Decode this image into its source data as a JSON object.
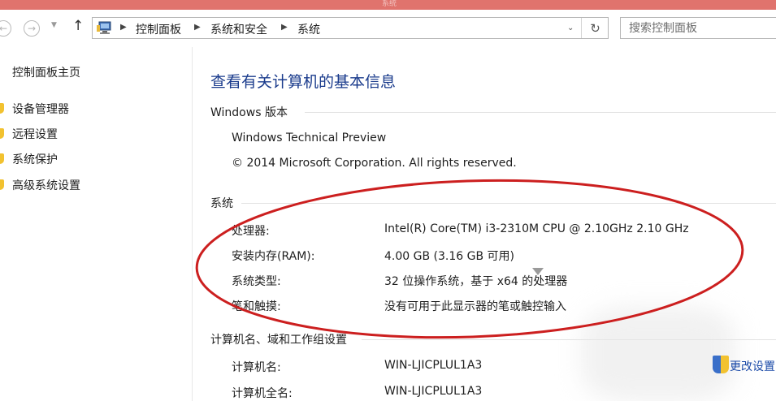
{
  "window": {
    "title": "系统"
  },
  "nav": {
    "back_icon": "arrow-left-icon",
    "forward_icon": "arrow-right-icon",
    "up_icon": "arrow-up-icon"
  },
  "address": {
    "breadcrumbs": [
      "控制面板",
      "系统和安全",
      "系统"
    ]
  },
  "search": {
    "placeholder": "搜索控制面板"
  },
  "sidebar": {
    "home": "控制面板主页",
    "items": [
      {
        "label": "设备管理器"
      },
      {
        "label": "远程设置"
      },
      {
        "label": "系统保护"
      },
      {
        "label": "高级系统设置"
      }
    ]
  },
  "main": {
    "title": "查看有关计算机的基本信息",
    "windows_section": {
      "heading": "Windows 版本",
      "edition": "Windows Technical Preview",
      "copyright": "© 2014 Microsoft Corporation. All rights reserved."
    },
    "system_section": {
      "heading": "系统",
      "rows": [
        {
          "label": "处理器:",
          "value": "Intel(R) Core(TM) i3-2310M CPU @ 2.10GHz   2.10 GHz"
        },
        {
          "label": "安装内存(RAM):",
          "value": "4.00 GB (3.16 GB 可用)"
        },
        {
          "label": "系统类型:",
          "value": "32 位操作系统，基于 x64 的处理器"
        },
        {
          "label": "笔和触摸:",
          "value": "没有可用于此显示器的笔或触控输入"
        }
      ]
    },
    "computer_section": {
      "heading": "计算机名、域和工作组设置",
      "rows": [
        {
          "label": "计算机名:",
          "value": "WIN-LJICPLUL1A3"
        },
        {
          "label": "计算机全名:",
          "value": "WIN-LJICPLUL1A3"
        }
      ],
      "change_link": "更改设置"
    }
  },
  "colors": {
    "title_blue": "#1a3b8c",
    "annotation_red": "#cc1f1f",
    "titlebar": "#e0736d"
  }
}
